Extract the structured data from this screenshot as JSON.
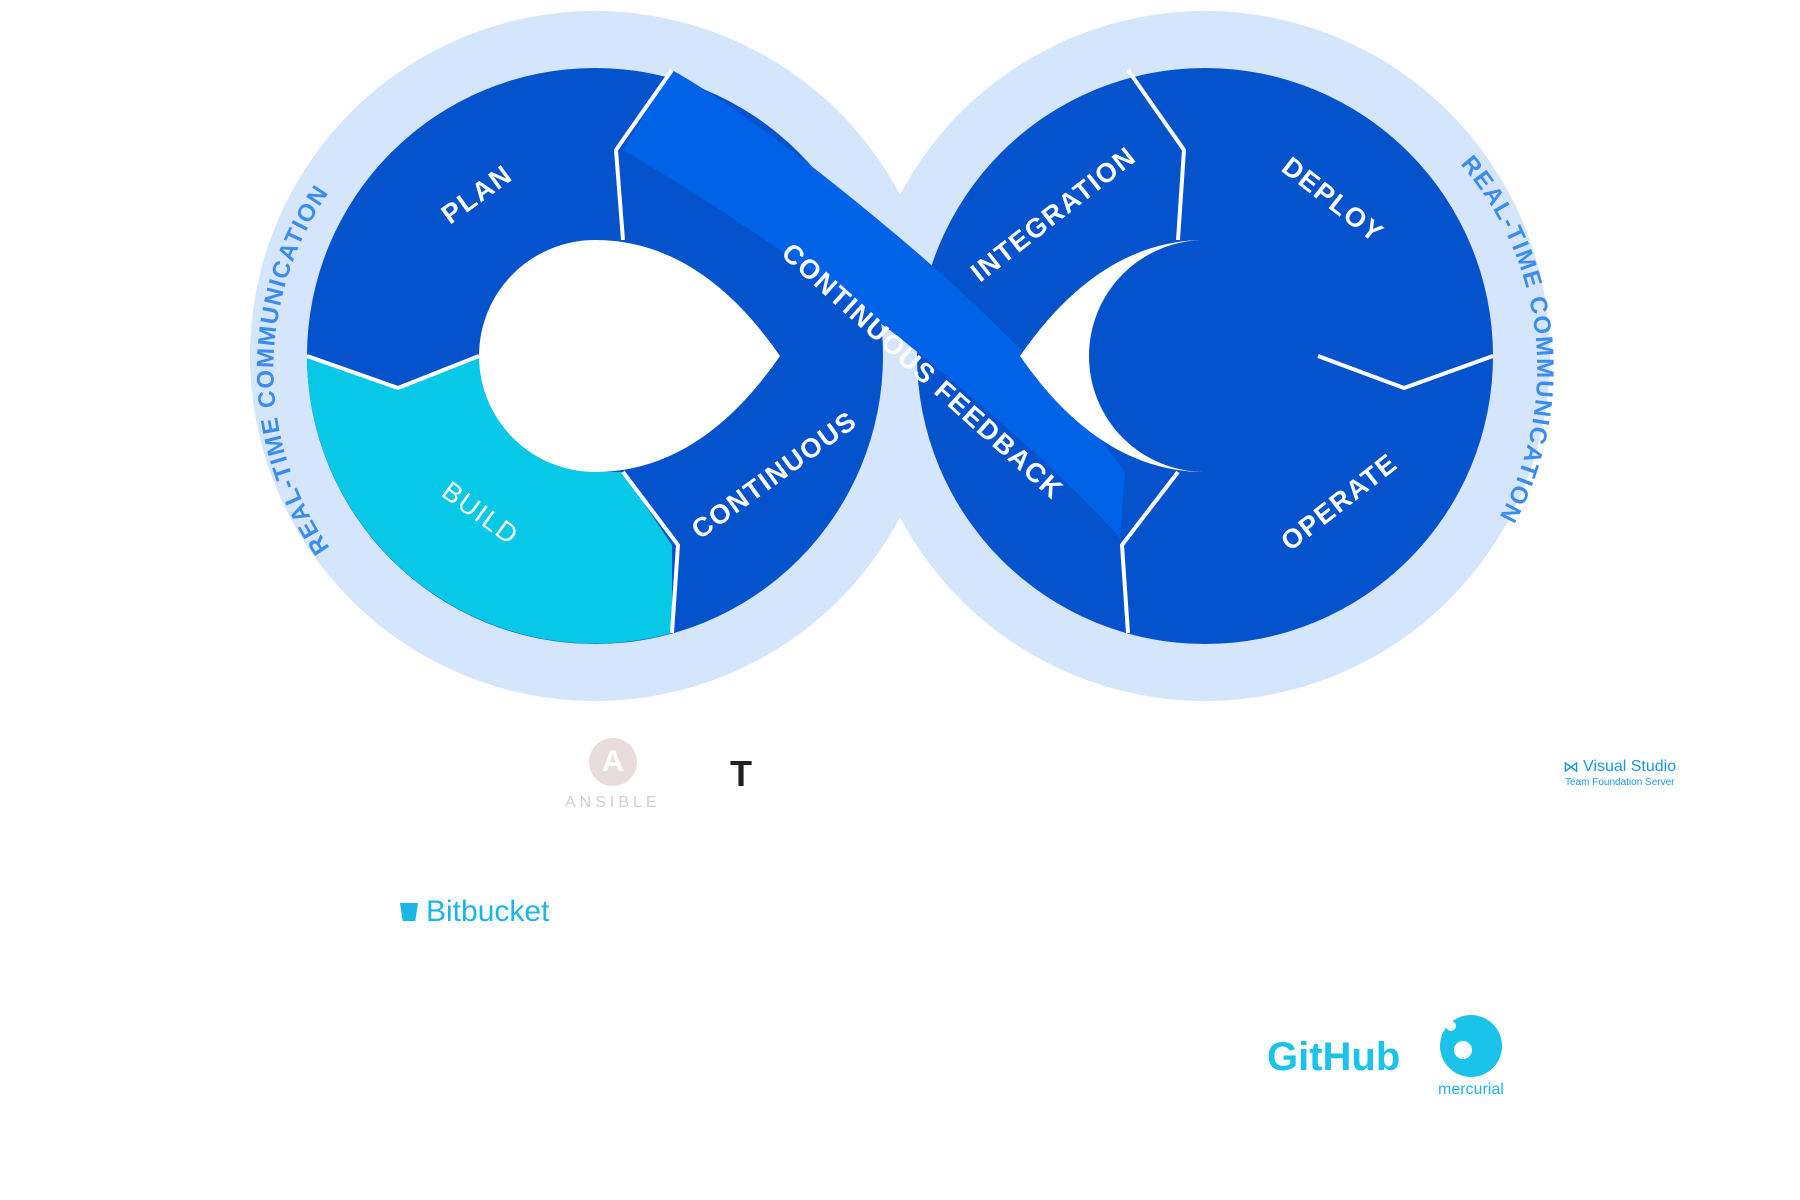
{
  "segments": {
    "plan": "PLAN",
    "build": "BUILD",
    "continuous": "CONTINUOUS",
    "continuous_feedback": "CONTINUOUS FEEDBACK",
    "integration": "INTEGRATION",
    "deploy": "DEPLOY",
    "operate": "OPERATE"
  },
  "ring": {
    "left": "REAL-TIME COMMUNICATION",
    "right": "REAL-TIME COMMUNICATION"
  },
  "logos": {
    "ansible": "ANSIBLE",
    "t": "T",
    "bitbucket": "Bitbucket",
    "github": "GitHub",
    "mercurial": "mercurial",
    "visual_studio": "Visual Studio",
    "visual_studio_sub": "Team Foundation Server"
  },
  "colors": {
    "ring": "#d4e5fc",
    "segment_dark": "#0452cc",
    "segment_mid": "#0062e6",
    "build": "#08c8e8",
    "ring_text": "#3b8cf0"
  }
}
